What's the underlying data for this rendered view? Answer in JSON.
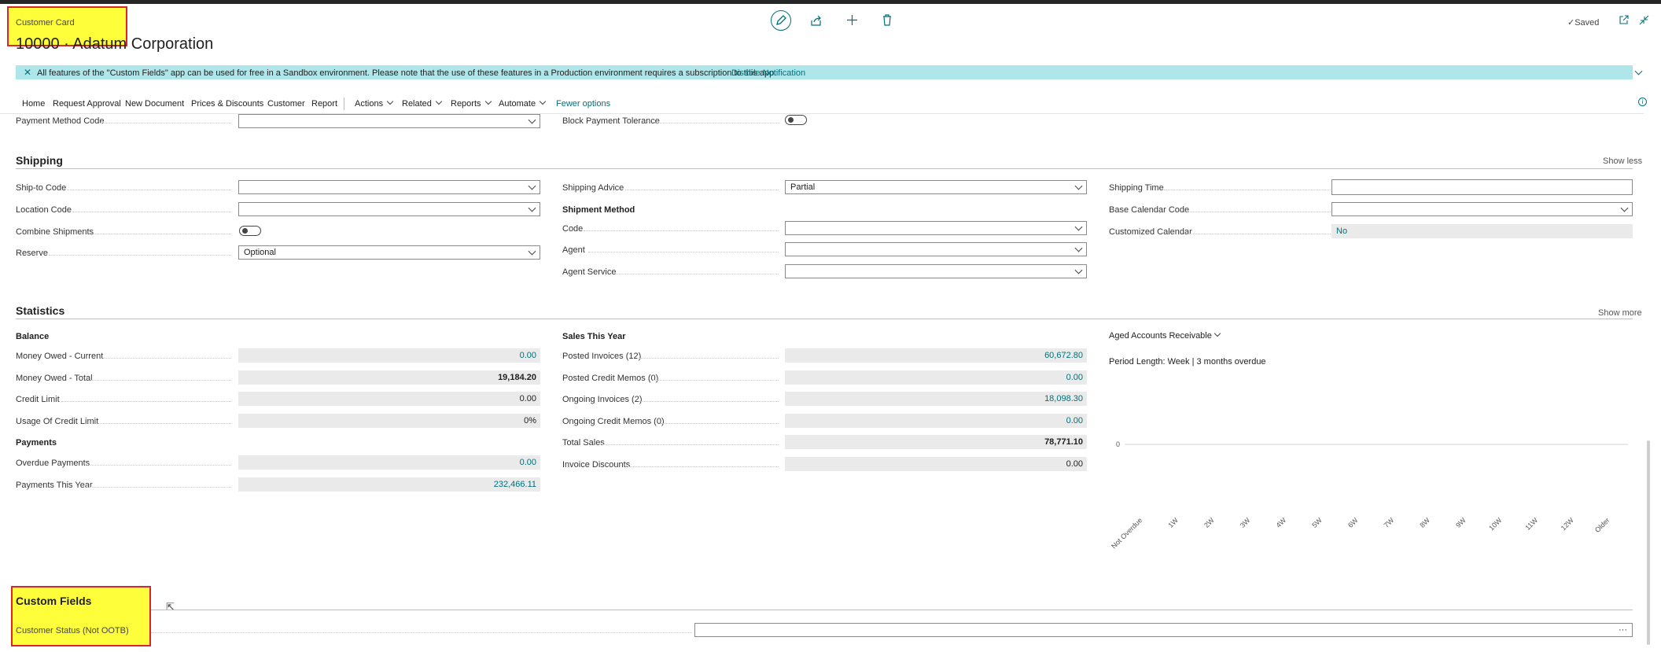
{
  "header": {
    "breadcrumb": "Customer Card",
    "title": "10000 · Adatum Corporation",
    "saved": "Saved"
  },
  "notification": {
    "text": "All features of the \"Custom Fields\" app can be used for free in a Sandbox environment. Please note that the use of these features in a Production environment requires a subscription to this app.",
    "action": "Disable Notification"
  },
  "nav": {
    "home": "Home",
    "request_approval": "Request Approval",
    "new_document": "New Document",
    "prices": "Prices & Discounts",
    "customer": "Customer",
    "report": "Report",
    "actions": "Actions",
    "related": "Related",
    "reports": "Reports",
    "automate": "Automate",
    "fewer": "Fewer options"
  },
  "payments_partial": {
    "payment_method_label": "Payment Method Code",
    "block_tolerance_label": "Block Payment Tolerance"
  },
  "shipping": {
    "title": "Shipping",
    "toggle": "Show less",
    "ship_to_label": "Ship-to Code",
    "location_label": "Location Code",
    "combine_label": "Combine Shipments",
    "reserve_label": "Reserve",
    "reserve_value": "Optional",
    "advice_label": "Shipping Advice",
    "advice_value": "Partial",
    "method_heading": "Shipment Method",
    "code_label": "Code",
    "agent_label": "Agent",
    "agent_service_label": "Agent Service",
    "time_label": "Shipping Time",
    "base_cal_label": "Base Calendar Code",
    "custom_cal_label": "Customized Calendar",
    "custom_cal_value": "No"
  },
  "statistics": {
    "title": "Statistics",
    "toggle": "Show more",
    "balance_heading": "Balance",
    "owed_current_label": "Money Owed - Current",
    "owed_current_value": "0.00",
    "owed_total_label": "Money Owed - Total",
    "owed_total_value": "19,184.20",
    "credit_limit_label": "Credit Limit",
    "credit_limit_value": "0.00",
    "usage_label": "Usage Of Credit Limit",
    "usage_value": "0%",
    "payments_heading": "Payments",
    "overdue_label": "Overdue Payments",
    "overdue_value": "0.00",
    "paid_year_label": "Payments This Year",
    "paid_year_value": "232,466.11",
    "sales_heading": "Sales This Year",
    "posted_inv_label": "Posted Invoices (12)",
    "posted_inv_value": "60,672.80",
    "posted_cm_label": "Posted Credit Memos (0)",
    "posted_cm_value": "0.00",
    "ongoing_inv_label": "Ongoing Invoices (2)",
    "ongoing_inv_value": "18,098.30",
    "ongoing_cm_label": "Ongoing Credit Memos (0)",
    "ongoing_cm_value": "0.00",
    "total_sales_label": "Total Sales",
    "total_sales_value": "78,771.10",
    "inv_disc_label": "Invoice Discounts",
    "inv_disc_value": "0.00",
    "aged_title": "Aged Accounts Receivable",
    "period_text": "Period Length: Week | 3 months overdue"
  },
  "chart_data": {
    "type": "bar",
    "categories": [
      "Not Overdue",
      "1W",
      "2W",
      "3W",
      "4W",
      "5W",
      "6W",
      "7W",
      "8W",
      "9W",
      "10W",
      "11W",
      "12W",
      "Older"
    ],
    "values": [
      0,
      0,
      0,
      0,
      0,
      0,
      0,
      0,
      0,
      0,
      0,
      0,
      0,
      0
    ],
    "yticks": [
      "0"
    ],
    "title": "",
    "xlabel": "",
    "ylabel": ""
  },
  "custom_fields": {
    "title": "Custom Fields",
    "status_label": "Customer Status (Not OOTB)",
    "more": "···"
  },
  "colors": {
    "accent": "#00707a",
    "notification_bg": "#aee6ea",
    "highlight": "#fefe3a",
    "highlight_border": "#d9262b"
  }
}
